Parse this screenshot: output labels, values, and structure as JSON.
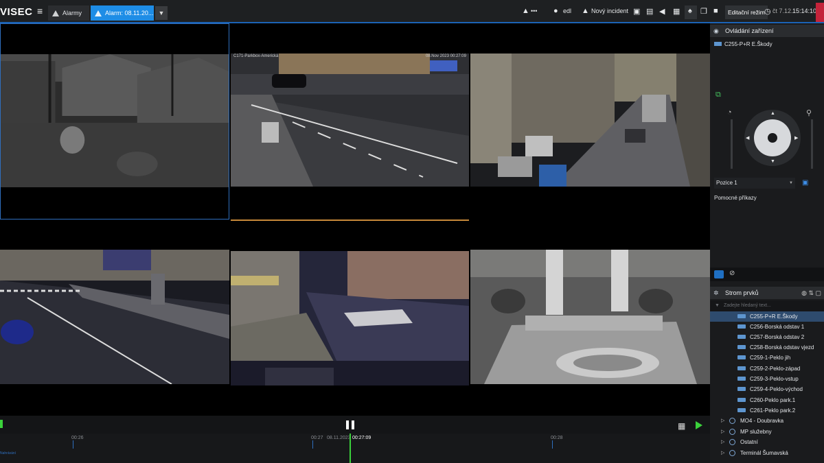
{
  "app": {
    "logo": "VISEC",
    "menu_icon": "hamburger-icon"
  },
  "tabs": [
    {
      "label": "Alarmy",
      "active": false
    },
    {
      "label": "Alarm: 08.11.20...",
      "active": true
    }
  ],
  "toolbar": {
    "alarm_dots": "•••",
    "user": "edl",
    "new_incident": "Nový incident",
    "edit_mode": "Editační režim",
    "date": "čt 7.12.",
    "time": "15:14:10"
  },
  "cameras": [
    {
      "label": "",
      "date": ""
    },
    {
      "label": "C171-Parkbox-Americká",
      "date": "08.Nov 2023 00:27:09"
    },
    {
      "label": "",
      "date": ""
    },
    {
      "label": "",
      "date": ""
    },
    {
      "label": "",
      "date": ""
    },
    {
      "label": "",
      "date": ""
    }
  ],
  "timeline": {
    "labels": [
      "00:26",
      "00:27",
      "00:28"
    ],
    "cursor_date": "08.11.2023",
    "cursor_time": "00:27:09",
    "bottom_label": "Nahrávání"
  },
  "device_control": {
    "title": "Ovládání zařízení",
    "device": "C255-P+R E.Škody",
    "position": "Pozice 1",
    "aux_commands": "Pomocné příkazy"
  },
  "tree": {
    "title": "Strom prvků",
    "search_placeholder": "Zadejte hledaný text...",
    "items": [
      {
        "label": "C255-P+R E.Škody",
        "selected": true
      },
      {
        "label": "C256-Borská odstav 1",
        "selected": false
      },
      {
        "label": "C257-Borská odstav 2",
        "selected": false
      },
      {
        "label": "C258-Borská odstav vjezd",
        "selected": false
      },
      {
        "label": "C259-1-Peklo jih",
        "selected": false
      },
      {
        "label": "C259-2-Peklo-západ",
        "selected": false
      },
      {
        "label": "C259-3-Peklo-vstup",
        "selected": false
      },
      {
        "label": "C259-4-Peklo-východ",
        "selected": false
      },
      {
        "label": "C260-Peklo park.1",
        "selected": false
      },
      {
        "label": "C261-Peklo park.2",
        "selected": false
      }
    ],
    "groups": [
      {
        "label": "MO4 - Doubravka"
      },
      {
        "label": "MP služebny"
      },
      {
        "label": "Ostatní"
      },
      {
        "label": "Terminál Šumavská"
      }
    ]
  },
  "colors": {
    "accent": "#1b63b6",
    "active_tab": "#1e8de6",
    "play": "#3bd23b"
  }
}
